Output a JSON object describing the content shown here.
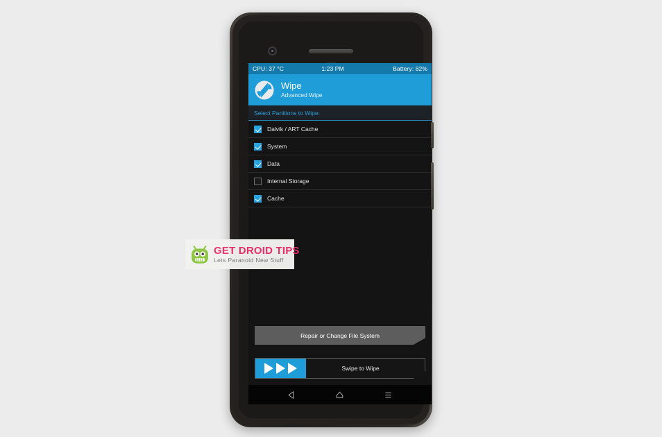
{
  "status_bar": {
    "cpu": "CPU: 37 °C",
    "time": "1:23 PM",
    "battery": "Battery: 82%",
    "bg_color": "#1479ab"
  },
  "app_header": {
    "title": "Wipe",
    "subtitle": "Advanced Wipe",
    "logo_icon": "twrp-logo-icon",
    "bg_color": "#1f9dd9"
  },
  "section": {
    "label": "Select Partitions to Wipe:",
    "accent_color": "#2e9fd8"
  },
  "partitions": [
    {
      "label": "Dalvik / ART Cache",
      "checked": true
    },
    {
      "label": "System",
      "checked": true
    },
    {
      "label": "Data",
      "checked": true
    },
    {
      "label": "Internal Storage",
      "checked": false
    },
    {
      "label": "Cache",
      "checked": true
    }
  ],
  "footer": {
    "repair_button": "Repair or Change File System",
    "swipe_label": "Swipe to Wipe",
    "swipe_arrow_count": 3,
    "swipe_accent_color": "#1f9dd9"
  },
  "nav_bar": {
    "back": "back-icon",
    "home": "home-icon",
    "recents": "recents-icon"
  },
  "watermark": {
    "title": "GET DROID TIPS",
    "tagline": "Lets Paranoid New Stuff",
    "mascot": "android-robot-icon",
    "title_color": "#ec2f6e",
    "mascot_color": "#8cc63f"
  }
}
